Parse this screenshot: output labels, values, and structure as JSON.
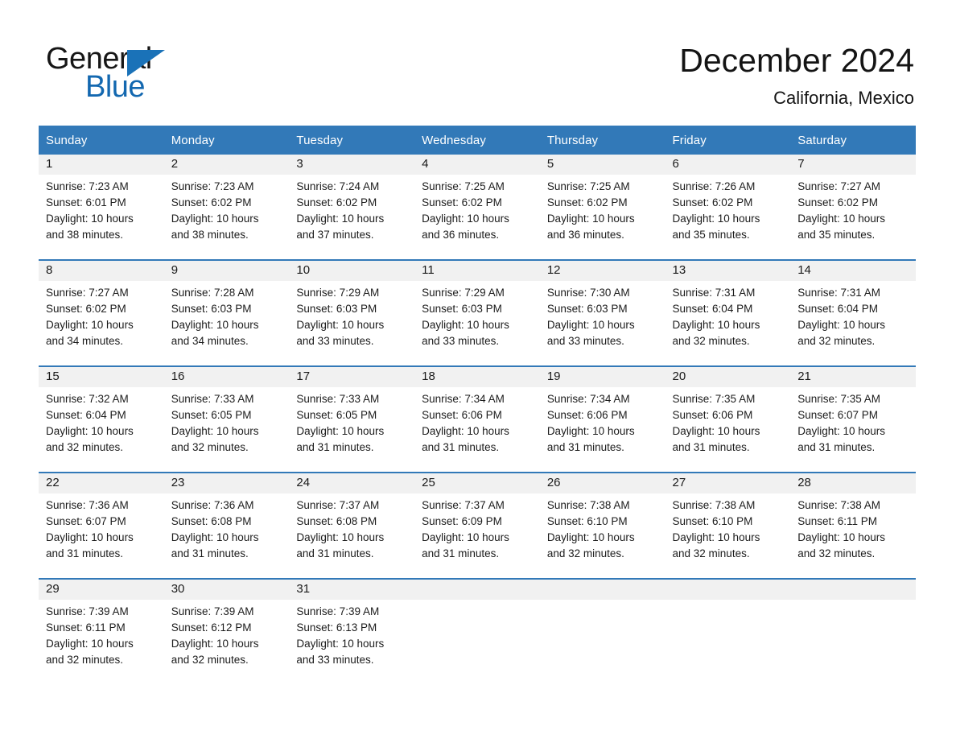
{
  "brand": {
    "name_part1": "General",
    "name_part2": "Blue",
    "triangle_color": "#1a72b8",
    "blue_text_color": "#1368b0"
  },
  "header": {
    "month_title": "December 2024",
    "location": "California, Mexico"
  },
  "theme": {
    "header_blue": "#3279b8",
    "daynum_band": "#f1f1f1",
    "text": "#1a1a1a"
  },
  "weekday_headers": [
    "Sunday",
    "Monday",
    "Tuesday",
    "Wednesday",
    "Thursday",
    "Friday",
    "Saturday"
  ],
  "weeks": [
    {
      "days": [
        {
          "num": "1",
          "sunrise": "Sunrise: 7:23 AM",
          "sunset": "Sunset: 6:01 PM",
          "daylight_1": "Daylight: 10 hours",
          "daylight_2": "and 38 minutes."
        },
        {
          "num": "2",
          "sunrise": "Sunrise: 7:23 AM",
          "sunset": "Sunset: 6:02 PM",
          "daylight_1": "Daylight: 10 hours",
          "daylight_2": "and 38 minutes."
        },
        {
          "num": "3",
          "sunrise": "Sunrise: 7:24 AM",
          "sunset": "Sunset: 6:02 PM",
          "daylight_1": "Daylight: 10 hours",
          "daylight_2": "and 37 minutes."
        },
        {
          "num": "4",
          "sunrise": "Sunrise: 7:25 AM",
          "sunset": "Sunset: 6:02 PM",
          "daylight_1": "Daylight: 10 hours",
          "daylight_2": "and 36 minutes."
        },
        {
          "num": "5",
          "sunrise": "Sunrise: 7:25 AM",
          "sunset": "Sunset: 6:02 PM",
          "daylight_1": "Daylight: 10 hours",
          "daylight_2": "and 36 minutes."
        },
        {
          "num": "6",
          "sunrise": "Sunrise: 7:26 AM",
          "sunset": "Sunset: 6:02 PM",
          "daylight_1": "Daylight: 10 hours",
          "daylight_2": "and 35 minutes."
        },
        {
          "num": "7",
          "sunrise": "Sunrise: 7:27 AM",
          "sunset": "Sunset: 6:02 PM",
          "daylight_1": "Daylight: 10 hours",
          "daylight_2": "and 35 minutes."
        }
      ]
    },
    {
      "days": [
        {
          "num": "8",
          "sunrise": "Sunrise: 7:27 AM",
          "sunset": "Sunset: 6:02 PM",
          "daylight_1": "Daylight: 10 hours",
          "daylight_2": "and 34 minutes."
        },
        {
          "num": "9",
          "sunrise": "Sunrise: 7:28 AM",
          "sunset": "Sunset: 6:03 PM",
          "daylight_1": "Daylight: 10 hours",
          "daylight_2": "and 34 minutes."
        },
        {
          "num": "10",
          "sunrise": "Sunrise: 7:29 AM",
          "sunset": "Sunset: 6:03 PM",
          "daylight_1": "Daylight: 10 hours",
          "daylight_2": "and 33 minutes."
        },
        {
          "num": "11",
          "sunrise": "Sunrise: 7:29 AM",
          "sunset": "Sunset: 6:03 PM",
          "daylight_1": "Daylight: 10 hours",
          "daylight_2": "and 33 minutes."
        },
        {
          "num": "12",
          "sunrise": "Sunrise: 7:30 AM",
          "sunset": "Sunset: 6:03 PM",
          "daylight_1": "Daylight: 10 hours",
          "daylight_2": "and 33 minutes."
        },
        {
          "num": "13",
          "sunrise": "Sunrise: 7:31 AM",
          "sunset": "Sunset: 6:04 PM",
          "daylight_1": "Daylight: 10 hours",
          "daylight_2": "and 32 minutes."
        },
        {
          "num": "14",
          "sunrise": "Sunrise: 7:31 AM",
          "sunset": "Sunset: 6:04 PM",
          "daylight_1": "Daylight: 10 hours",
          "daylight_2": "and 32 minutes."
        }
      ]
    },
    {
      "days": [
        {
          "num": "15",
          "sunrise": "Sunrise: 7:32 AM",
          "sunset": "Sunset: 6:04 PM",
          "daylight_1": "Daylight: 10 hours",
          "daylight_2": "and 32 minutes."
        },
        {
          "num": "16",
          "sunrise": "Sunrise: 7:33 AM",
          "sunset": "Sunset: 6:05 PM",
          "daylight_1": "Daylight: 10 hours",
          "daylight_2": "and 32 minutes."
        },
        {
          "num": "17",
          "sunrise": "Sunrise: 7:33 AM",
          "sunset": "Sunset: 6:05 PM",
          "daylight_1": "Daylight: 10 hours",
          "daylight_2": "and 31 minutes."
        },
        {
          "num": "18",
          "sunrise": "Sunrise: 7:34 AM",
          "sunset": "Sunset: 6:06 PM",
          "daylight_1": "Daylight: 10 hours",
          "daylight_2": "and 31 minutes."
        },
        {
          "num": "19",
          "sunrise": "Sunrise: 7:34 AM",
          "sunset": "Sunset: 6:06 PM",
          "daylight_1": "Daylight: 10 hours",
          "daylight_2": "and 31 minutes."
        },
        {
          "num": "20",
          "sunrise": "Sunrise: 7:35 AM",
          "sunset": "Sunset: 6:06 PM",
          "daylight_1": "Daylight: 10 hours",
          "daylight_2": "and 31 minutes."
        },
        {
          "num": "21",
          "sunrise": "Sunrise: 7:35 AM",
          "sunset": "Sunset: 6:07 PM",
          "daylight_1": "Daylight: 10 hours",
          "daylight_2": "and 31 minutes."
        }
      ]
    },
    {
      "days": [
        {
          "num": "22",
          "sunrise": "Sunrise: 7:36 AM",
          "sunset": "Sunset: 6:07 PM",
          "daylight_1": "Daylight: 10 hours",
          "daylight_2": "and 31 minutes."
        },
        {
          "num": "23",
          "sunrise": "Sunrise: 7:36 AM",
          "sunset": "Sunset: 6:08 PM",
          "daylight_1": "Daylight: 10 hours",
          "daylight_2": "and 31 minutes."
        },
        {
          "num": "24",
          "sunrise": "Sunrise: 7:37 AM",
          "sunset": "Sunset: 6:08 PM",
          "daylight_1": "Daylight: 10 hours",
          "daylight_2": "and 31 minutes."
        },
        {
          "num": "25",
          "sunrise": "Sunrise: 7:37 AM",
          "sunset": "Sunset: 6:09 PM",
          "daylight_1": "Daylight: 10 hours",
          "daylight_2": "and 31 minutes."
        },
        {
          "num": "26",
          "sunrise": "Sunrise: 7:38 AM",
          "sunset": "Sunset: 6:10 PM",
          "daylight_1": "Daylight: 10 hours",
          "daylight_2": "and 32 minutes."
        },
        {
          "num": "27",
          "sunrise": "Sunrise: 7:38 AM",
          "sunset": "Sunset: 6:10 PM",
          "daylight_1": "Daylight: 10 hours",
          "daylight_2": "and 32 minutes."
        },
        {
          "num": "28",
          "sunrise": "Sunrise: 7:38 AM",
          "sunset": "Sunset: 6:11 PM",
          "daylight_1": "Daylight: 10 hours",
          "daylight_2": "and 32 minutes."
        }
      ]
    },
    {
      "days": [
        {
          "num": "29",
          "sunrise": "Sunrise: 7:39 AM",
          "sunset": "Sunset: 6:11 PM",
          "daylight_1": "Daylight: 10 hours",
          "daylight_2": "and 32 minutes."
        },
        {
          "num": "30",
          "sunrise": "Sunrise: 7:39 AM",
          "sunset": "Sunset: 6:12 PM",
          "daylight_1": "Daylight: 10 hours",
          "daylight_2": "and 32 minutes."
        },
        {
          "num": "31",
          "sunrise": "Sunrise: 7:39 AM",
          "sunset": "Sunset: 6:13 PM",
          "daylight_1": "Daylight: 10 hours",
          "daylight_2": "and 33 minutes."
        },
        {
          "num": "",
          "sunrise": "",
          "sunset": "",
          "daylight_1": "",
          "daylight_2": ""
        },
        {
          "num": "",
          "sunrise": "",
          "sunset": "",
          "daylight_1": "",
          "daylight_2": ""
        },
        {
          "num": "",
          "sunrise": "",
          "sunset": "",
          "daylight_1": "",
          "daylight_2": ""
        },
        {
          "num": "",
          "sunrise": "",
          "sunset": "",
          "daylight_1": "",
          "daylight_2": ""
        }
      ]
    }
  ]
}
